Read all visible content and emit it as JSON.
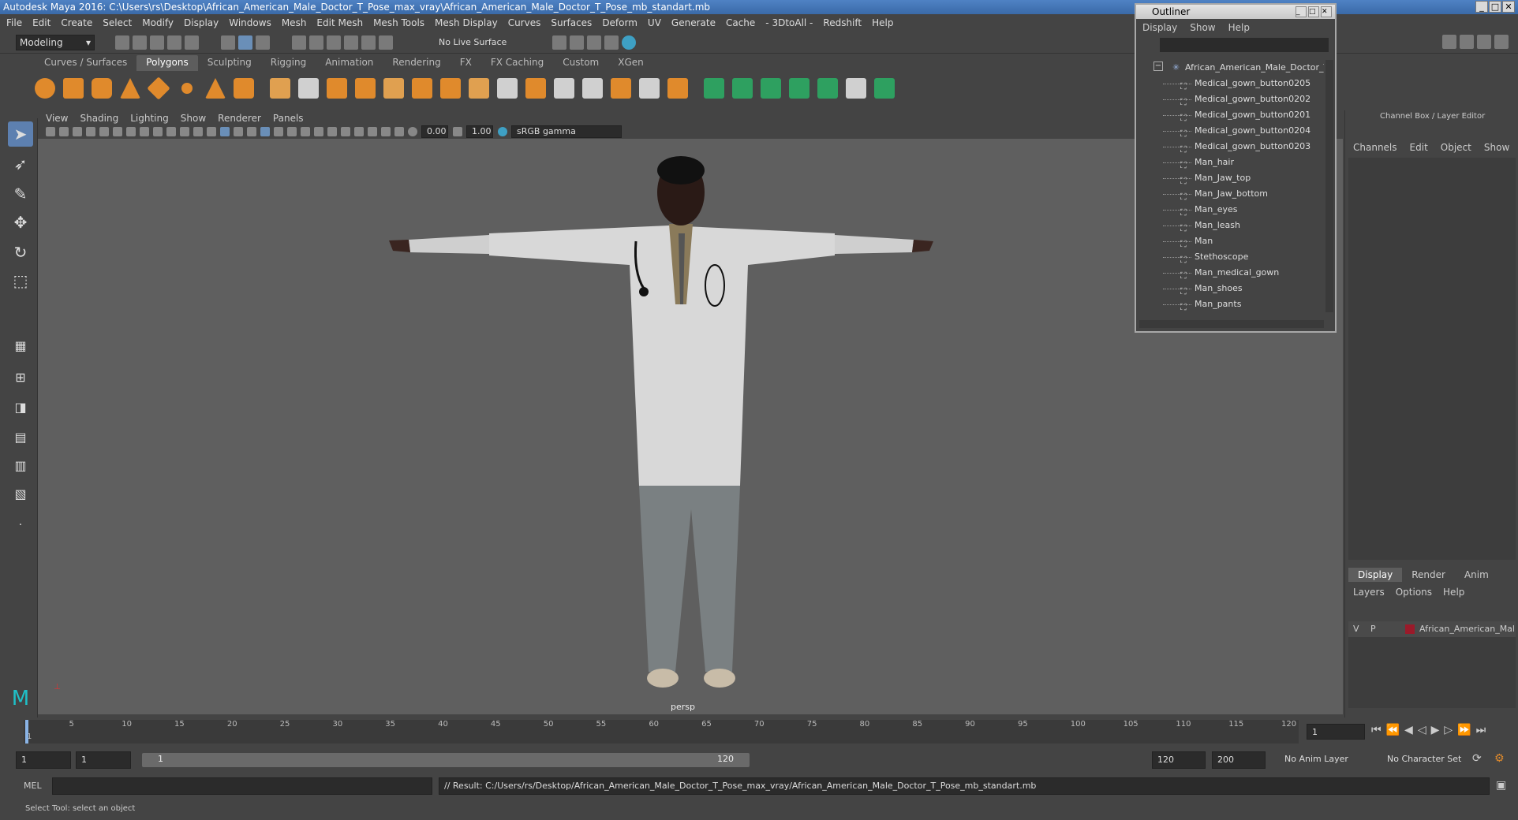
{
  "window": {
    "title": "Autodesk Maya 2016: C:\\Users\\rs\\Desktop\\African_American_Male_Doctor_T_Pose_max_vray\\African_American_Male_Doctor_T_Pose_mb_standart.mb"
  },
  "menubar": [
    "File",
    "Edit",
    "Create",
    "Select",
    "Modify",
    "Display",
    "Windows",
    "Mesh",
    "Edit Mesh",
    "Mesh Tools",
    "Mesh Display",
    "Curves",
    "Surfaces",
    "Deform",
    "UV",
    "Generate",
    "Cache",
    "- 3DtoAll -",
    "Redshift",
    "Help"
  ],
  "status": {
    "mode": "Modeling",
    "live_surface": "No Live Surface"
  },
  "shelf": {
    "tabs": [
      "Curves / Surfaces",
      "Polygons",
      "Sculpting",
      "Rigging",
      "Animation",
      "Rendering",
      "FX",
      "FX Caching",
      "Custom",
      "XGen"
    ],
    "active_tab": "Polygons"
  },
  "viewport": {
    "menu": [
      "View",
      "Shading",
      "Lighting",
      "Show",
      "Renderer",
      "Panels"
    ],
    "exposure": "0.00",
    "gamma": "1.00",
    "color_space": "sRGB gamma",
    "camera_label": "persp"
  },
  "outliner": {
    "title": "Outliner",
    "menu": [
      "Display",
      "Show",
      "Help"
    ],
    "root": "African_American_Male_Doctor_T_",
    "items": [
      "Medical_gown_button0205",
      "Medical_gown_button0202",
      "Medical_gown_button0201",
      "Medical_gown_button0204",
      "Medical_gown_button0203",
      "Man_hair",
      "Man_Jaw_top",
      "Man_Jaw_bottom",
      "Man_eyes",
      "Man_leash",
      "Man",
      "Stethoscope",
      "Man_medical_gown",
      "Man_shoes",
      "Man_pants"
    ]
  },
  "channel_box": {
    "title": "Channel Box / Layer Editor",
    "menu": [
      "Channels",
      "Edit",
      "Object",
      "Show"
    ],
    "layer_tabs": [
      "Display",
      "Render",
      "Anim"
    ],
    "layer_menu": [
      "Layers",
      "Options",
      "Help"
    ],
    "layer": {
      "v": "V",
      "p": "P",
      "name": "African_American_Mal",
      "color": "#9a1a2a"
    }
  },
  "timeline": {
    "ticks": [
      "1",
      "5",
      "10",
      "15",
      "20",
      "25",
      "30",
      "35",
      "40",
      "45",
      "50",
      "55",
      "60",
      "65",
      "70",
      "75",
      "80",
      "85",
      "90",
      "95",
      "100",
      "105",
      "110",
      "115",
      "120"
    ],
    "current_frame": "1"
  },
  "range": {
    "start": "1",
    "start2": "1",
    "slider_start": "1",
    "slider_end": "120",
    "end": "120",
    "end2": "200",
    "anim_layer": "No Anim Layer",
    "char_set": "No Character Set"
  },
  "command": {
    "lang": "MEL",
    "result": "// Result: C:/Users/rs/Desktop/African_American_Male_Doctor_T_Pose_max_vray/African_American_Male_Doctor_T_Pose_mb_standart.mb"
  },
  "help_line": "Select Tool: select an object"
}
